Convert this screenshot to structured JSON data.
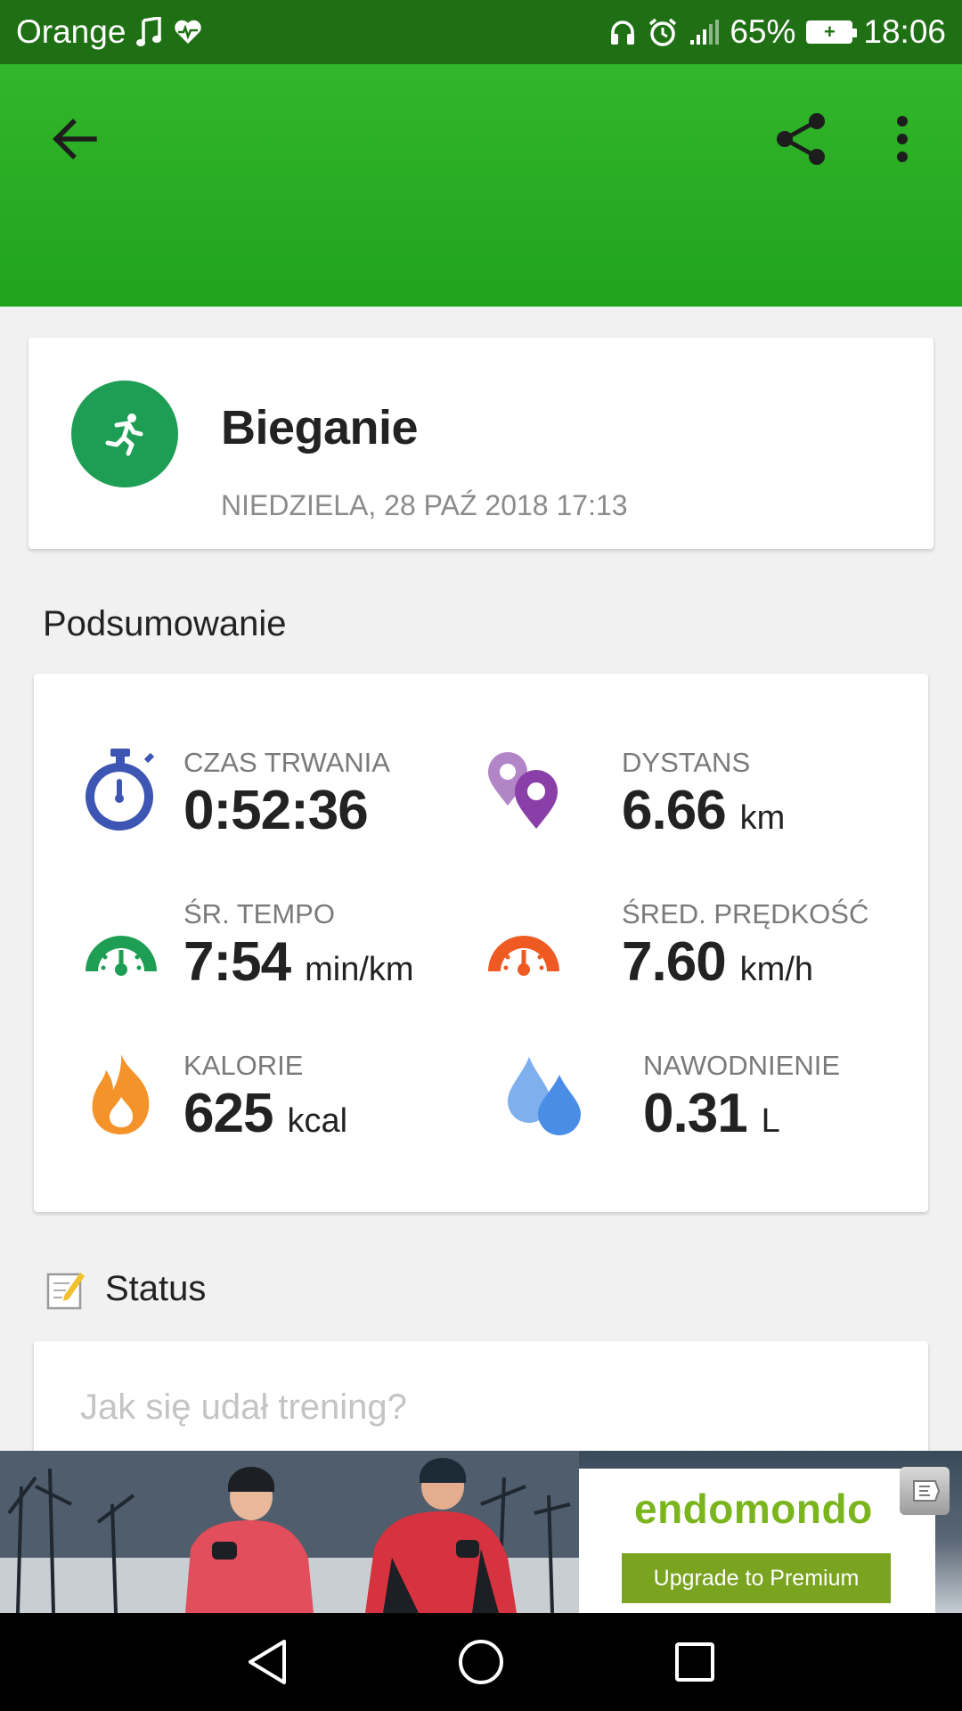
{
  "status_bar": {
    "carrier": "Orange",
    "battery_percent": "65%",
    "time": "18:06",
    "icons": [
      "music-icon",
      "heart-pulse-icon",
      "headphones-icon",
      "alarm-icon",
      "signal-icon",
      "battery-charging-icon"
    ]
  },
  "app_bar": {
    "back_icon": "arrow-left-icon",
    "share_icon": "share-icon",
    "more_icon": "more-vert-icon",
    "color": "#2bb024"
  },
  "workout": {
    "sport": "Bieganie",
    "date": "NIEDZIELA, 28 PAŹ 2018 17:13",
    "sport_icon": "running-icon",
    "sport_color": "#1e9e54"
  },
  "summary": {
    "title": "Podsumowanie",
    "duration": {
      "label": "CZAS TRWANIA",
      "value": "0:52:36",
      "unit": "",
      "icon": "stopwatch-icon",
      "color": "#3d55b3"
    },
    "distance": {
      "label": "DYSTANS",
      "value": "6.66",
      "unit": "km",
      "icon": "map-pins-icon",
      "color": "#8a3fa8"
    },
    "pace": {
      "label": "ŚR. TEMPO",
      "value": "7:54",
      "unit": "min/km",
      "icon": "speedometer-green-icon",
      "color": "#1e9e54"
    },
    "speed": {
      "label": "ŚRED. PRĘDKOŚĆ",
      "value": "7.60",
      "unit": "km/h",
      "icon": "speedometer-orange-icon",
      "color": "#ee5a22"
    },
    "calories": {
      "label": "KALORIE",
      "value": "625",
      "unit": "kcal",
      "icon": "flame-icon",
      "color": "#f4932a"
    },
    "hydration": {
      "label": "NAWODNIENIE",
      "value": "0.31",
      "unit": "L",
      "icon": "water-drops-icon",
      "color": "#4a8de6"
    }
  },
  "status_section": {
    "title": "Status",
    "icon": "note-edit-icon",
    "placeholder": "Jak się udał trening?"
  },
  "ad": {
    "brand": "endomondo",
    "cta": "Upgrade to Premium",
    "brand_color": "#7ab51d"
  },
  "nav_bar": {
    "icons": [
      "back-triangle-icon",
      "home-circle-icon",
      "recents-square-icon"
    ]
  }
}
